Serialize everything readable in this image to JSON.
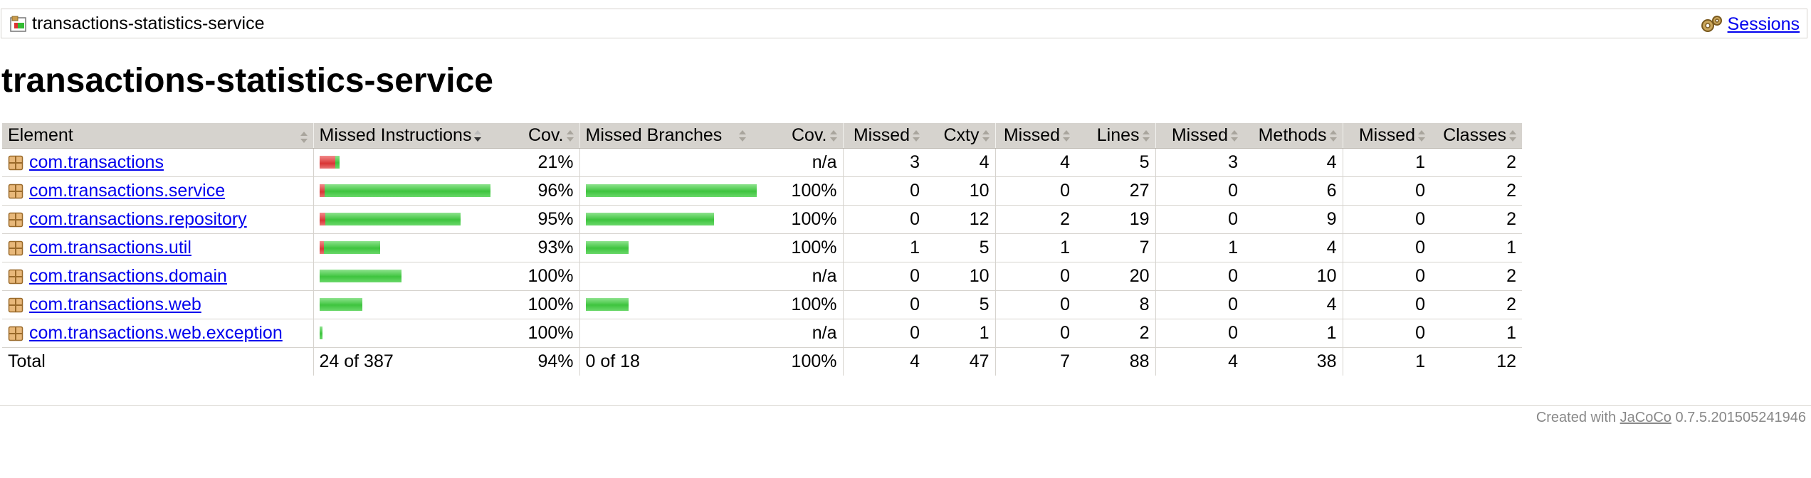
{
  "breadcrumb": {
    "title": "transactions-statistics-service",
    "sessions_label": "Sessions"
  },
  "page_title": "transactions-statistics-service",
  "table": {
    "headers": {
      "element": "Element",
      "missed_instructions": "Missed Instructions",
      "cov1": "Cov.",
      "missed_branches": "Missed Branches",
      "cov2": "Cov.",
      "missed_cxty": "Missed",
      "cxty": "Cxty",
      "missed_lines": "Missed",
      "lines": "Lines",
      "missed_methods": "Missed",
      "methods": "Methods",
      "missed_classes": "Missed",
      "classes": "Classes"
    },
    "rows": [
      {
        "name": "com.transactions",
        "instr_bar": {
          "missed": 0.09,
          "covered": 0.025
        },
        "instr_cov": "21%",
        "branch_bar": null,
        "branch_cov": "n/a",
        "missed_cxty": "3",
        "cxty": "4",
        "missed_lines": "4",
        "lines": "5",
        "missed_methods": "3",
        "methods": "4",
        "missed_classes": "1",
        "classes": "2"
      },
      {
        "name": "com.transactions.service",
        "instr_bar": {
          "missed": 0.03,
          "covered": 0.97
        },
        "instr_cov": "96%",
        "branch_bar": {
          "missed": 0,
          "covered": 1.0
        },
        "branch_cov": "100%",
        "missed_cxty": "0",
        "cxty": "10",
        "missed_lines": "0",
        "lines": "27",
        "missed_methods": "0",
        "methods": "6",
        "missed_classes": "0",
        "classes": "2"
      },
      {
        "name": "com.transactions.repository",
        "instr_bar": {
          "missed": 0.035,
          "covered": 0.79
        },
        "instr_cov": "95%",
        "branch_bar": {
          "missed": 0,
          "covered": 0.75
        },
        "branch_cov": "100%",
        "missed_cxty": "0",
        "cxty": "12",
        "missed_lines": "2",
        "lines": "19",
        "missed_methods": "0",
        "methods": "9",
        "missed_classes": "0",
        "classes": "2"
      },
      {
        "name": "com.transactions.util",
        "instr_bar": {
          "missed": 0.025,
          "covered": 0.33
        },
        "instr_cov": "93%",
        "branch_bar": {
          "missed": 0,
          "covered": 0.25
        },
        "branch_cov": "100%",
        "missed_cxty": "1",
        "cxty": "5",
        "missed_lines": "1",
        "lines": "7",
        "missed_methods": "1",
        "methods": "4",
        "missed_classes": "0",
        "classes": "1"
      },
      {
        "name": "com.transactions.domain",
        "instr_bar": {
          "missed": 0,
          "covered": 0.48
        },
        "instr_cov": "100%",
        "branch_bar": null,
        "branch_cov": "n/a",
        "missed_cxty": "0",
        "cxty": "10",
        "missed_lines": "0",
        "lines": "20",
        "missed_methods": "0",
        "methods": "10",
        "missed_classes": "0",
        "classes": "2"
      },
      {
        "name": "com.transactions.web",
        "instr_bar": {
          "missed": 0,
          "covered": 0.25
        },
        "instr_cov": "100%",
        "branch_bar": {
          "missed": 0,
          "covered": 0.25
        },
        "branch_cov": "100%",
        "missed_cxty": "0",
        "cxty": "5",
        "missed_lines": "0",
        "lines": "8",
        "missed_methods": "0",
        "methods": "4",
        "missed_classes": "0",
        "classes": "2"
      },
      {
        "name": "com.transactions.web.exception",
        "instr_bar": {
          "missed": 0,
          "covered": 0.015
        },
        "instr_cov": "100%",
        "branch_bar": null,
        "branch_cov": "n/a",
        "missed_cxty": "0",
        "cxty": "1",
        "missed_lines": "0",
        "lines": "2",
        "missed_methods": "0",
        "methods": "1",
        "missed_classes": "0",
        "classes": "1"
      }
    ],
    "total": {
      "label": "Total",
      "missed_instructions": "24 of 387",
      "instr_cov": "94%",
      "missed_branches": "0 of 18",
      "branch_cov": "100%",
      "missed_cxty": "4",
      "cxty": "47",
      "missed_lines": "7",
      "lines": "88",
      "missed_methods": "4",
      "methods": "38",
      "missed_classes": "1",
      "classes": "12"
    }
  },
  "footer": {
    "prefix": "Created with ",
    "link": "JaCoCo",
    "version": " 0.7.5.201505241946"
  },
  "colors": {
    "header_bg": "#d6d3ce",
    "link": "#0000ee",
    "bar_red": "#d93636",
    "bar_green": "#3ec43e"
  }
}
